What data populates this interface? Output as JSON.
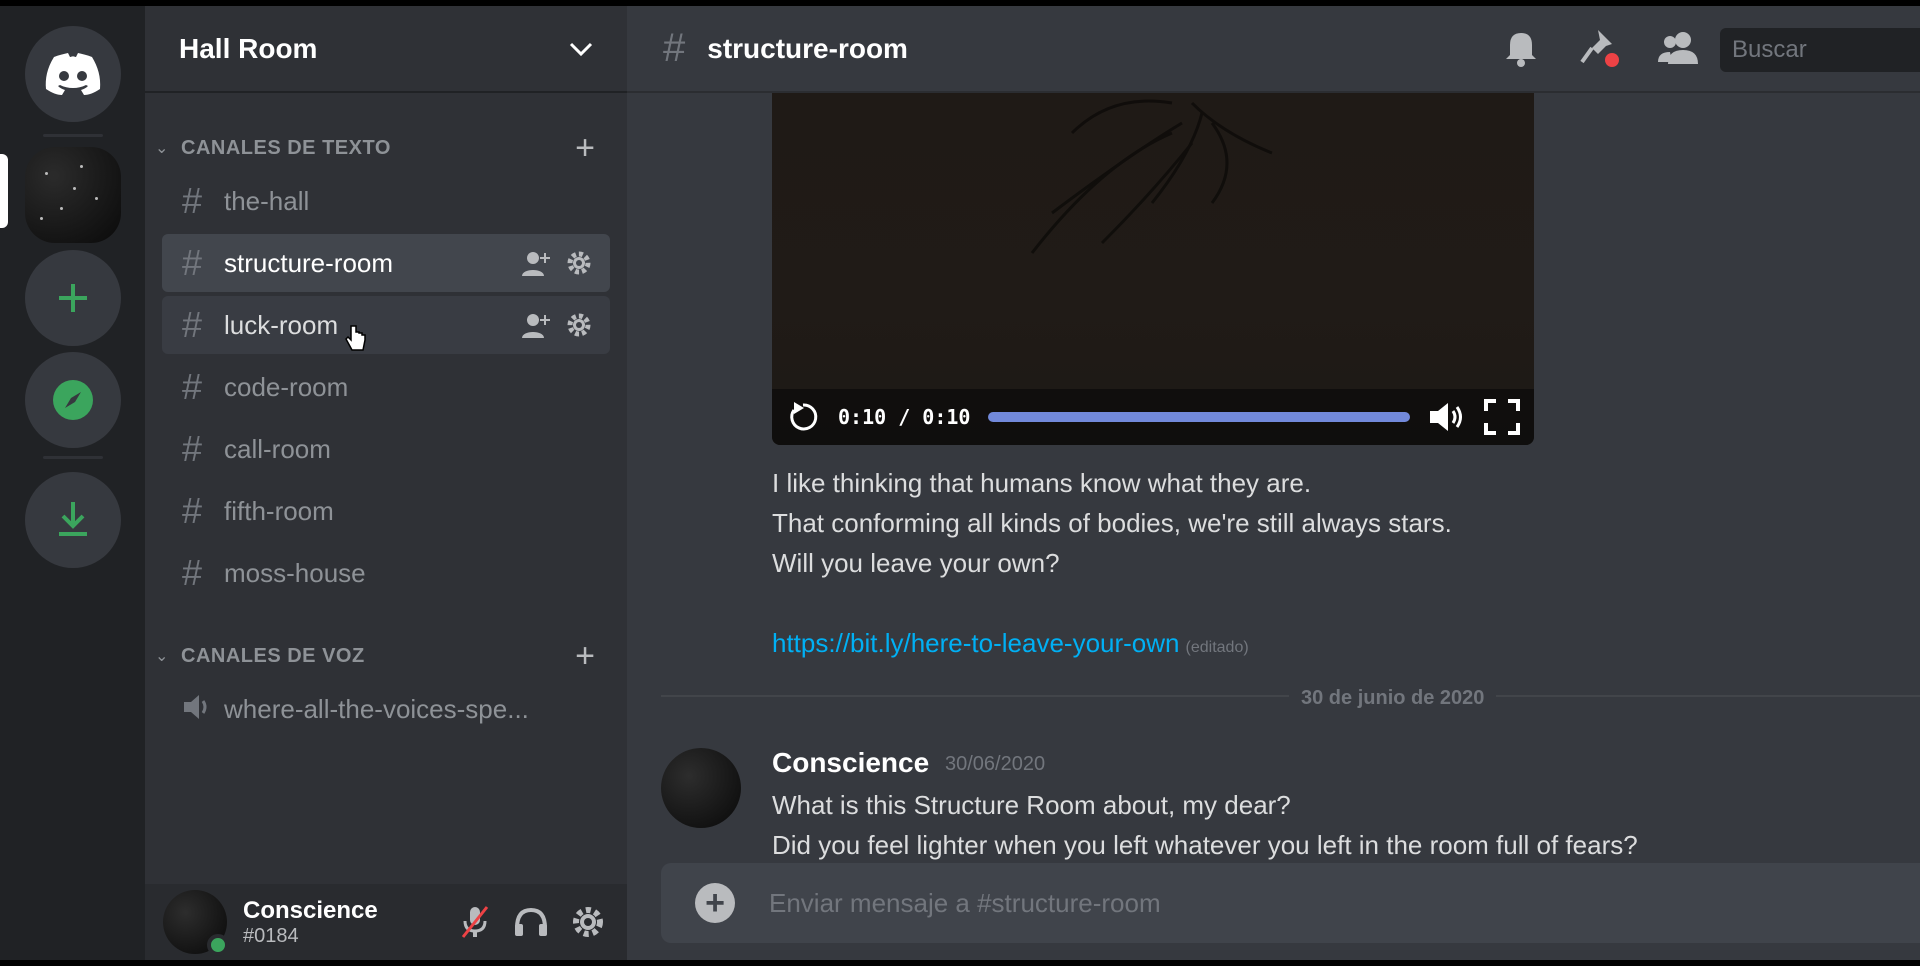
{
  "server": {
    "name": "Hall Room"
  },
  "sidebar": {
    "categories": [
      {
        "label": "CANALES DE TEXTO"
      },
      {
        "label": "CANALES DE VOZ"
      }
    ],
    "text_channels": [
      {
        "name": "the-hall"
      },
      {
        "name": "structure-room"
      },
      {
        "name": "luck-room"
      },
      {
        "name": "code-room"
      },
      {
        "name": "call-room"
      },
      {
        "name": "fifth-room"
      },
      {
        "name": "moss-house"
      }
    ],
    "voice_channels": [
      {
        "name": "where-all-the-voices-spe..."
      }
    ]
  },
  "user": {
    "name": "Conscience",
    "tag": "#0184"
  },
  "channel": {
    "hash": "#",
    "name": "structure-room"
  },
  "search": {
    "placeholder": "Buscar"
  },
  "video": {
    "time": "0:10 / 0:10",
    "progress": 1.0
  },
  "message1": {
    "lines": [
      "I like thinking that humans know what they are.",
      "That conforming all kinds of bodies, we're still always stars.",
      "Will you leave your own?"
    ],
    "link": "https://bit.ly/here-to-leave-your-own",
    "edited": "(editado)"
  },
  "date_divider": "30 de junio de 2020",
  "message2": {
    "author": "Conscience",
    "timestamp": "30/06/2020",
    "lines": [
      "What is this Structure Room about, my dear?",
      "Did you feel lighter when you left whatever you left in the room full of fears?"
    ]
  },
  "composer": {
    "placeholder": "Enviar mensaje a #structure-room"
  },
  "colors": {
    "accent": "#7289da",
    "green": "#3ba55d",
    "link": "#00b0f4",
    "notification": "#ed4245"
  }
}
